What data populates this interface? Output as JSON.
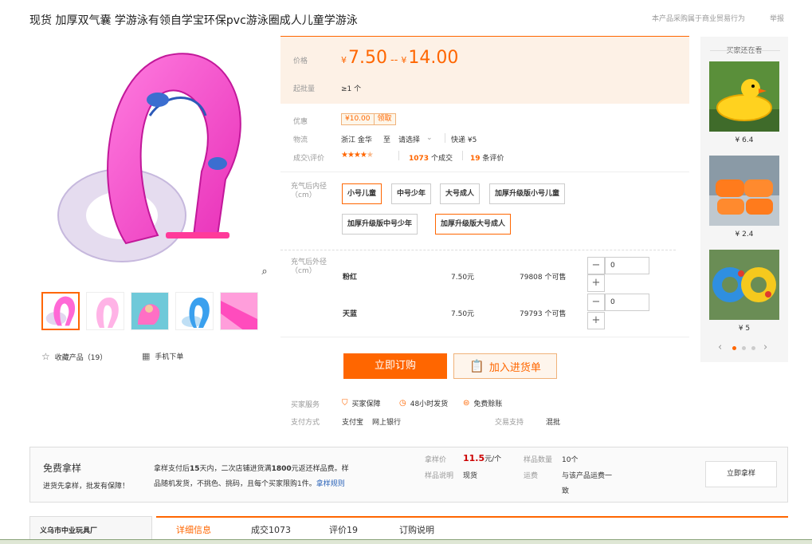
{
  "header": {
    "title": "现货 加厚双气囊 学游泳有领自学宝环保pvc游泳圈成人儿童学游泳",
    "disclaimer": "本产品采购属于商业贸易行为",
    "report": "举报"
  },
  "gallery": {
    "fav_label": "收藏产品（19）",
    "mobile_label": "手机下单"
  },
  "price": {
    "label": "价格",
    "currency": "¥",
    "min": "7.50",
    "sep": "--",
    "max": "14.00",
    "moq_label": "起批量",
    "moq": "≥1 个"
  },
  "promo": {
    "label": "优惠",
    "coupon_value": "¥10.00",
    "coupon_action": "领取"
  },
  "logistics": {
    "label": "物流",
    "origin": "浙江 金华",
    "to": "至",
    "dest": "请选择",
    "express": "快递 ¥5"
  },
  "reviews": {
    "label": "成交\\评价",
    "deals_num": "1073",
    "deals_suffix": "个成交",
    "reviews_num": "19",
    "reviews_suffix": "条评价",
    "rating": 4.5
  },
  "sizes": {
    "label": "充气后内径（cm）",
    "options": [
      "小号儿童",
      "中号少年",
      "大号成人",
      "加厚升级版小号儿童",
      "加厚升级版中号少年",
      "加厚升级版大号成人"
    ]
  },
  "variants": {
    "label": "充气后外径（cm）",
    "rows": [
      {
        "color": "粉红",
        "price": "7.50元",
        "stock": "79808 个可售",
        "qty": "0"
      },
      {
        "color": "天蓝",
        "price": "7.50元",
        "stock": "79793 个可售",
        "qty": "0"
      }
    ]
  },
  "actions": {
    "order": "立即订购",
    "cart": "加入进货单"
  },
  "services": {
    "label": "买家服务",
    "items": [
      "买家保障",
      "48小时发货",
      "免费赊账"
    ],
    "pay_label": "支付方式",
    "pay_items": [
      "支付宝",
      "网上银行"
    ],
    "trade_label": "交易支持",
    "trade_value": "混批"
  },
  "side": {
    "title": "买家还在看",
    "items": [
      {
        "price": "¥ 6.4"
      },
      {
        "price": "¥ 2.4"
      },
      {
        "price": "¥ 5"
      }
    ]
  },
  "sample": {
    "title": "免费拿样",
    "subtitle": "进货先拿样，批发有保障！",
    "desc_1a": "拿样支付后",
    "desc_1b": "15",
    "desc_1c": "天内，二次店铺进货满",
    "desc_1d": "1800",
    "desc_1e": "元返还样品费。样",
    "desc_2": "品随机发货，不挑色、挑码，且每个买家限购1件。",
    "rule_link": "拿样规则",
    "price_label": "拿样价",
    "price_value": "11.5",
    "price_unit": "元/个",
    "count_label": "样品数量",
    "count_value": "10个",
    "note_label": "样品说明",
    "note_value": "现货",
    "ship_label": "运费",
    "ship_value_1": "与该产品运费一",
    "ship_value_2": "致",
    "button": "立即拿样"
  },
  "bottom": {
    "company": "义乌市中业玩具厂",
    "tabs": [
      "详细信息",
      "成交1073",
      "评价19",
      "订购说明"
    ]
  },
  "colors": {
    "accent": "#ff6600",
    "price_bg": "#fdf1e6"
  }
}
